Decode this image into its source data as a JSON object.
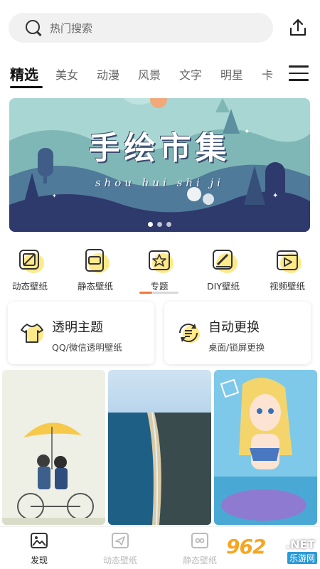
{
  "search": {
    "placeholder": "热门搜索"
  },
  "categories": [
    "精选",
    "美女",
    "动漫",
    "风景",
    "文字",
    "明星",
    "卡"
  ],
  "banner": {
    "title": "手绘市集",
    "subtitle": "shou hui shi ji",
    "page_count": 3,
    "active_page": 1
  },
  "features": [
    {
      "label": "动态壁纸",
      "icon": "dynamic-wallpaper-icon"
    },
    {
      "label": "静态壁纸",
      "icon": "static-wallpaper-icon"
    },
    {
      "label": "专题",
      "icon": "topic-icon"
    },
    {
      "label": "DIY壁纸",
      "icon": "diy-wallpaper-icon"
    },
    {
      "label": "视频壁纸",
      "icon": "video-wallpaper-icon"
    }
  ],
  "cards": [
    {
      "title": "透明主题",
      "subtitle": "QQ/微信透明壁纸",
      "icon": "tshirt-icon"
    },
    {
      "title": "自动更换",
      "subtitle": "桌面/锁屏更换",
      "icon": "refresh-icon"
    }
  ],
  "bottom_nav": [
    {
      "label": "发现",
      "icon": "image-icon",
      "active": true
    },
    {
      "label": "动态壁纸",
      "icon": "send-icon",
      "active": false
    },
    {
      "label": "静态壁纸",
      "icon": "cat-icon",
      "active": false
    }
  ],
  "watermark": {
    "number": "962",
    "net": ".NET",
    "cn": "乐游网"
  },
  "colors": {
    "accent": "#f07a3a",
    "highlight": "#ffe36b",
    "banner_bg": "#2e3a6b"
  }
}
